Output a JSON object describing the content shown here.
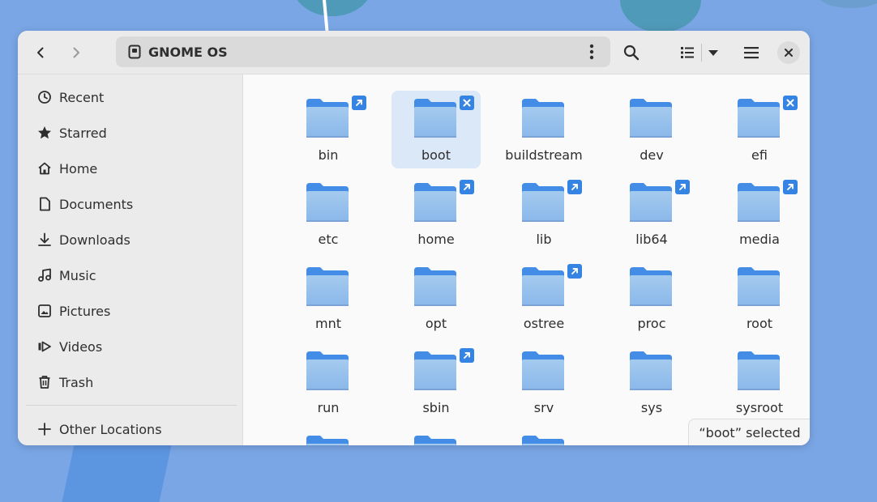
{
  "window": {
    "nav_back_icon": "chevron-left-icon",
    "nav_forward_icon": "chevron-right-icon",
    "location": "GNOME OS",
    "location_icon": "drive-icon",
    "status": "“boot” selected"
  },
  "sidebar": {
    "items": [
      {
        "label": "Recent",
        "icon": "clock-icon"
      },
      {
        "label": "Starred",
        "icon": "star-icon"
      },
      {
        "label": "Home",
        "icon": "home-icon"
      },
      {
        "label": "Documents",
        "icon": "document-icon"
      },
      {
        "label": "Downloads",
        "icon": "download-icon"
      },
      {
        "label": "Music",
        "icon": "music-icon"
      },
      {
        "label": "Pictures",
        "icon": "pictures-icon"
      },
      {
        "label": "Videos",
        "icon": "video-icon"
      },
      {
        "label": "Trash",
        "icon": "trash-icon"
      }
    ],
    "other": {
      "label": "Other Locations",
      "icon": "plus-icon"
    }
  },
  "files": [
    {
      "name": "bin",
      "badge": "link"
    },
    {
      "name": "boot",
      "badge": "blocked",
      "selected": true
    },
    {
      "name": "buildstream",
      "badge": ""
    },
    {
      "name": "dev",
      "badge": ""
    },
    {
      "name": "efi",
      "badge": "blocked"
    },
    {
      "name": "etc",
      "badge": ""
    },
    {
      "name": "home",
      "badge": "link"
    },
    {
      "name": "lib",
      "badge": "link"
    },
    {
      "name": "lib64",
      "badge": "link"
    },
    {
      "name": "media",
      "badge": "link"
    },
    {
      "name": "mnt",
      "badge": ""
    },
    {
      "name": "opt",
      "badge": ""
    },
    {
      "name": "ostree",
      "badge": "link"
    },
    {
      "name": "proc",
      "badge": ""
    },
    {
      "name": "root",
      "badge": ""
    },
    {
      "name": "run",
      "badge": ""
    },
    {
      "name": "sbin",
      "badge": "link"
    },
    {
      "name": "srv",
      "badge": ""
    },
    {
      "name": "sys",
      "badge": ""
    },
    {
      "name": "sysroot",
      "badge": ""
    },
    {
      "name": "",
      "badge": ""
    },
    {
      "name": "",
      "badge": ""
    },
    {
      "name": "",
      "badge": ""
    }
  ],
  "colors": {
    "accent": "#3584e4",
    "folder_back": "#438de6",
    "folder_front_top": "#a4caee",
    "folder_front_bottom": "#8ab8ea",
    "selection": "#dbe8f7"
  }
}
